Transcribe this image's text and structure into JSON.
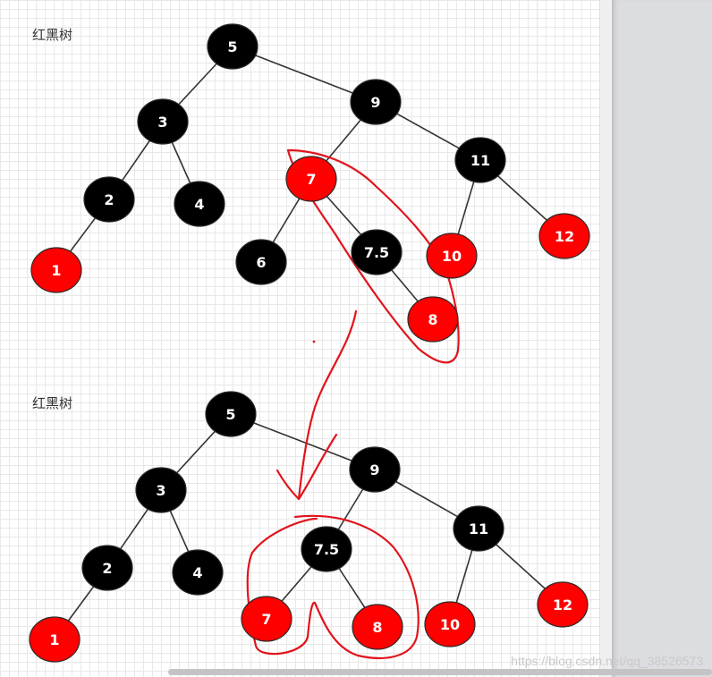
{
  "colors": {
    "black_node": "#000000",
    "red_node": "#ff0000",
    "edge": "#333333",
    "annotation": "#e1141c"
  },
  "top_tree": {
    "title": "红黑树",
    "nodes": [
      {
        "id": "n5",
        "label": "5",
        "color": "black"
      },
      {
        "id": "n3",
        "label": "3",
        "color": "black"
      },
      {
        "id": "n9",
        "label": "9",
        "color": "black"
      },
      {
        "id": "n2",
        "label": "2",
        "color": "black"
      },
      {
        "id": "n4",
        "label": "4",
        "color": "black"
      },
      {
        "id": "n7",
        "label": "7",
        "color": "red"
      },
      {
        "id": "n11",
        "label": "11",
        "color": "black"
      },
      {
        "id": "n1",
        "label": "1",
        "color": "red"
      },
      {
        "id": "n6",
        "label": "6",
        "color": "black"
      },
      {
        "id": "n7_5",
        "label": "7.5",
        "color": "black"
      },
      {
        "id": "n10",
        "label": "10",
        "color": "red"
      },
      {
        "id": "n12",
        "label": "12",
        "color": "red"
      },
      {
        "id": "n8",
        "label": "8",
        "color": "red"
      }
    ],
    "edges": [
      [
        "n5",
        "n3"
      ],
      [
        "n5",
        "n9"
      ],
      [
        "n3",
        "n2"
      ],
      [
        "n3",
        "n4"
      ],
      [
        "n2",
        "n1"
      ],
      [
        "n9",
        "n7"
      ],
      [
        "n9",
        "n11"
      ],
      [
        "n7",
        "n6"
      ],
      [
        "n7",
        "n7_5"
      ],
      [
        "n7_5",
        "n8"
      ],
      [
        "n11",
        "n10"
      ],
      [
        "n11",
        "n12"
      ]
    ]
  },
  "bottom_tree": {
    "title": "红黑树",
    "nodes": [
      {
        "id": "m5",
        "label": "5",
        "color": "black"
      },
      {
        "id": "m3",
        "label": "3",
        "color": "black"
      },
      {
        "id": "m9",
        "label": "9",
        "color": "black"
      },
      {
        "id": "m2",
        "label": "2",
        "color": "black"
      },
      {
        "id": "m4",
        "label": "4",
        "color": "black"
      },
      {
        "id": "m7_5",
        "label": "7.5",
        "color": "black"
      },
      {
        "id": "m11",
        "label": "11",
        "color": "black"
      },
      {
        "id": "m1",
        "label": "1",
        "color": "red"
      },
      {
        "id": "m7",
        "label": "7",
        "color": "red"
      },
      {
        "id": "m8",
        "label": "8",
        "color": "red"
      },
      {
        "id": "m10",
        "label": "10",
        "color": "red"
      },
      {
        "id": "m12",
        "label": "12",
        "color": "red"
      }
    ],
    "edges": [
      [
        "m5",
        "m3"
      ],
      [
        "m5",
        "m9"
      ],
      [
        "m3",
        "m2"
      ],
      [
        "m3",
        "m4"
      ],
      [
        "m2",
        "m1"
      ],
      [
        "m9",
        "m7_5"
      ],
      [
        "m9",
        "m11"
      ],
      [
        "m7_5",
        "m7"
      ],
      [
        "m7_5",
        "m8"
      ],
      [
        "m11",
        "m10"
      ],
      [
        "m11",
        "m12"
      ]
    ]
  },
  "watermark": "https://blog.csdn.net/qq_38526573"
}
